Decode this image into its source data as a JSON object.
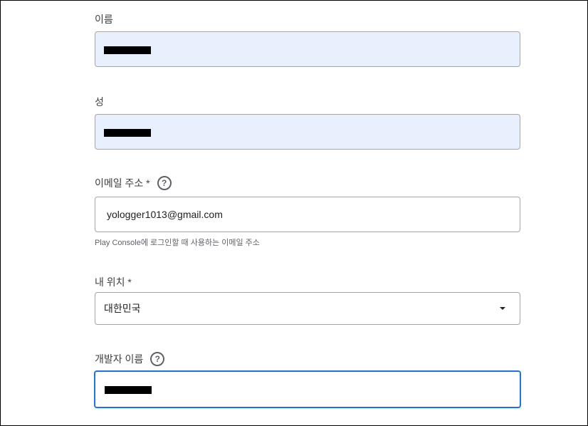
{
  "form": {
    "first_name": {
      "label": "이름",
      "value": "[redacted]"
    },
    "last_name": {
      "label": "성",
      "value": "[redacted]"
    },
    "email": {
      "label": "이메일 주소 *",
      "value": "yologger1013@gmail.com",
      "hint": "Play Console에 로그인할 때 사용하는 이메일 주소",
      "help_icon": "help-icon"
    },
    "location": {
      "label": "내 위치 *",
      "selected": "대한민국",
      "arrow_icon": "dropdown-arrow-icon"
    },
    "developer_name": {
      "label": "개발자 이름",
      "value": "[redacted]",
      "help_icon": "help-icon"
    }
  },
  "colors": {
    "autofill_bg": "#e8f0fe",
    "focus_border": "#1a73e8",
    "field_border": "#a6a6a6",
    "hint_text": "#5f6368"
  }
}
